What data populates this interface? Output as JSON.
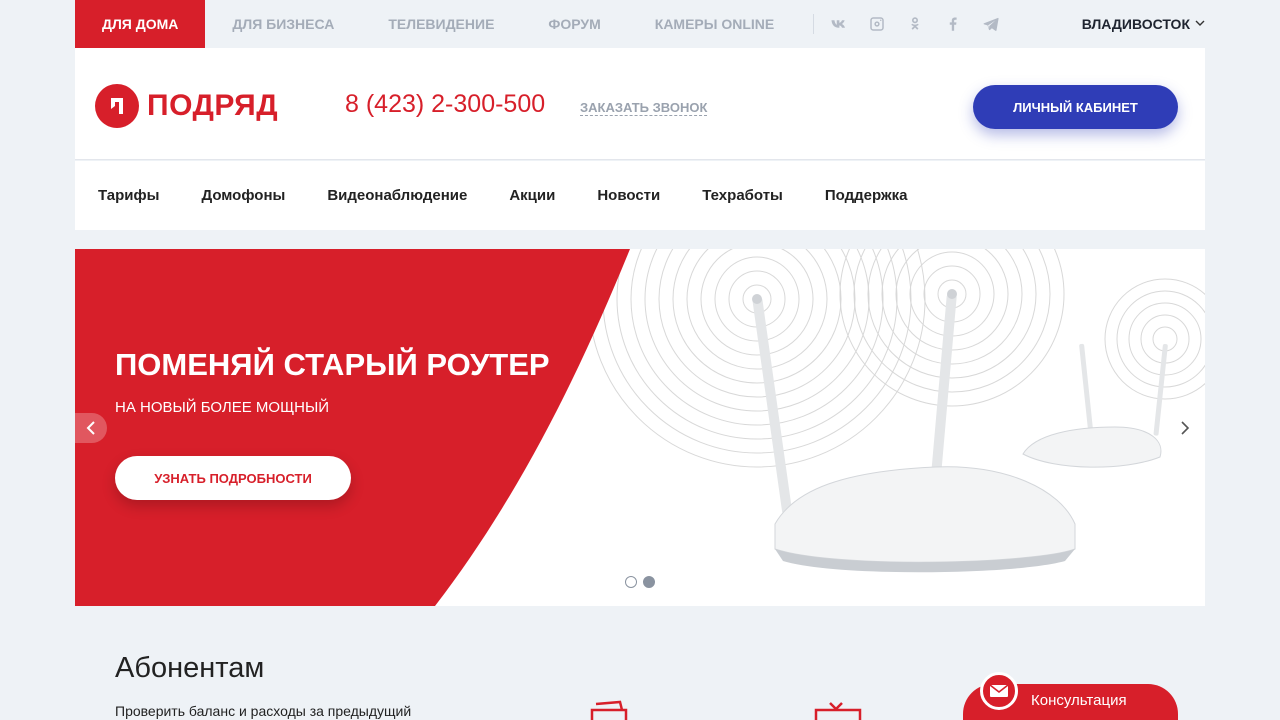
{
  "topbar": {
    "tabs": [
      {
        "label": "Для дома",
        "active": true
      },
      {
        "label": "Для бизнеса",
        "active": false
      },
      {
        "label": "Телевидение",
        "active": false
      },
      {
        "label": "Форум",
        "active": false
      },
      {
        "label": "Камеры online",
        "active": false
      }
    ],
    "social": [
      "vk-icon",
      "instagram-icon",
      "odnoklassniki-icon",
      "facebook-icon",
      "telegram-icon"
    ],
    "city": "ВЛАДИВОСТОК"
  },
  "header": {
    "logo_text": "ПОДРЯД",
    "phone": "8 (423) 2-300-500",
    "callback": "ЗАКАЗАТЬ ЗВОНОК",
    "cabinet": "ЛИЧНЫЙ КАБИНЕТ"
  },
  "nav": [
    "Тарифы",
    "Домофоны",
    "Видеонаблюдение",
    "Акции",
    "Новости",
    "Техработы",
    "Поддержка"
  ],
  "banner": {
    "title": "ПОМЕНЯЙ СТАРЫЙ РОУТЕР",
    "subtitle": "НА НОВЫЙ БОЛЕЕ МОЩНЫЙ",
    "button": "УЗНАТЬ ПОДРОБНОСТИ",
    "slides_total": 2,
    "active_slide": 2
  },
  "section": {
    "title": "Абонентам",
    "text": "Проверить баланс и расходы за предыдущий"
  },
  "consult": {
    "label": "Консультация"
  },
  "colors": {
    "brand_red": "#d71f2a",
    "cabinet_blue": "#2f3db7",
    "page_bg": "#eef2f6"
  }
}
